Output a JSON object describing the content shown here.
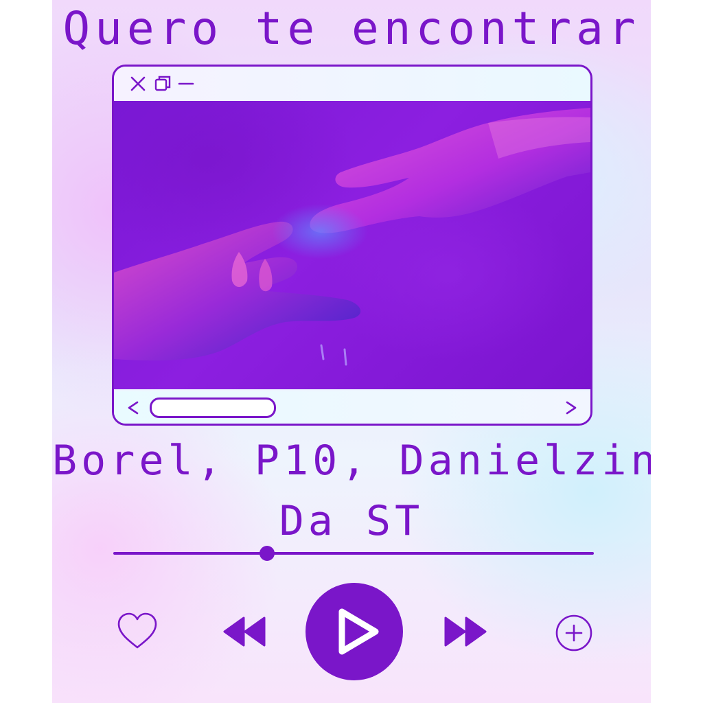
{
  "song": {
    "title": "Quero te encontrar"
  },
  "artist": {
    "line1": "Borel, P10, Danielzin",
    "line2": "Da ST"
  },
  "window": {
    "controls": [
      "close-icon",
      "maximize-icon",
      "minimize-icon"
    ],
    "image": "two-hands-reaching-neon-purple"
  },
  "player": {
    "progress_fraction": 0.32,
    "icons": [
      "heart-icon",
      "rewind-icon",
      "play-icon",
      "fast-forward-icon",
      "plus-circle-icon"
    ]
  },
  "colors": {
    "accent": "#7a16c9",
    "media_bg": "#8c1fe0"
  }
}
